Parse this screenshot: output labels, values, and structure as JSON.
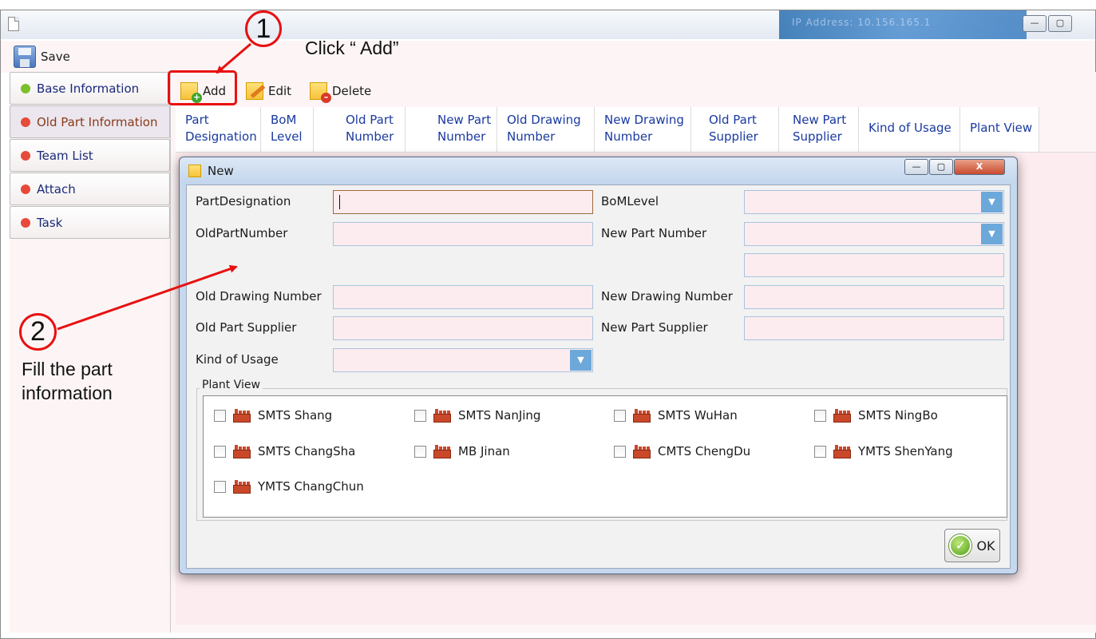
{
  "window": {
    "title_blur": "IP Address: 10.156.165.1",
    "controls": {
      "minimize": "—",
      "maximize": "▢"
    }
  },
  "menubar": {
    "save_label": "Save"
  },
  "sidebar": {
    "items": [
      {
        "label": "Base Information",
        "dot_color": "#7bbf2a"
      },
      {
        "label": "Old Part Information",
        "dot_color": "#e64a3a"
      },
      {
        "label": "Team List",
        "dot_color": "#e64a3a"
      },
      {
        "label": "Attach",
        "dot_color": "#e64a3a"
      },
      {
        "label": "Task",
        "dot_color": "#e64a3a"
      }
    ]
  },
  "toolbar": {
    "add_label": "Add",
    "edit_label": "Edit",
    "delete_label": "Delete"
  },
  "grid": {
    "columns": [
      [
        "Part",
        "Designation"
      ],
      [
        "BoM",
        "Level"
      ],
      [
        "Old Part",
        "Number"
      ],
      [
        "New Part",
        "Number"
      ],
      [
        "Old Drawing",
        "Number"
      ],
      [
        "New Drawing",
        "Number"
      ],
      [
        "Old Part",
        "Supplier"
      ],
      [
        "New Part",
        "Supplier"
      ],
      [
        "Kind of Usage",
        ""
      ],
      [
        "Plant View",
        ""
      ]
    ]
  },
  "dialog": {
    "title": "New",
    "controls": {
      "minimize": "—",
      "maximize": "▢",
      "close": "X"
    },
    "labels": {
      "part_designation": "PartDesignation",
      "bom_level": "BoMLevel",
      "old_part_number": "OldPartNumber",
      "new_part_number": "New Part Number",
      "old_drawing_number": "Old Drawing Number",
      "new_drawing_number": "New Drawing Number",
      "old_part_supplier": "Old Part Supplier",
      "new_part_supplier": "New Part Supplier",
      "kind_of_usage": "Kind of Usage"
    },
    "values": {
      "part_designation": "",
      "bom_level": "",
      "old_part_number": "",
      "new_part_number": "",
      "new_part_number_extra": "",
      "old_drawing_number": "",
      "new_drawing_number": "",
      "old_part_supplier": "",
      "new_part_supplier": "",
      "kind_of_usage": ""
    },
    "plant_view_label": "Plant View",
    "plants": [
      {
        "label": "SMTS Shang",
        "checked": false
      },
      {
        "label": "SMTS NanJing",
        "checked": false
      },
      {
        "label": "SMTS WuHan",
        "checked": false
      },
      {
        "label": "SMTS NingBo",
        "checked": false
      },
      {
        "label": "SMTS ChangSha",
        "checked": false
      },
      {
        "label": "MB Jinan",
        "checked": false
      },
      {
        "label": "CMTS ChengDu",
        "checked": false
      },
      {
        "label": "YMTS ShenYang",
        "checked": false
      },
      {
        "label": "YMTS ChangChun",
        "checked": false
      }
    ],
    "ok_label": "OK"
  },
  "annotations": {
    "step1_number": "1",
    "step1_text": "Click “ Add”",
    "step2_number": "2",
    "step2_text_line1": "Fill the part",
    "step2_text_line2": "information",
    "color": "#e81010"
  }
}
